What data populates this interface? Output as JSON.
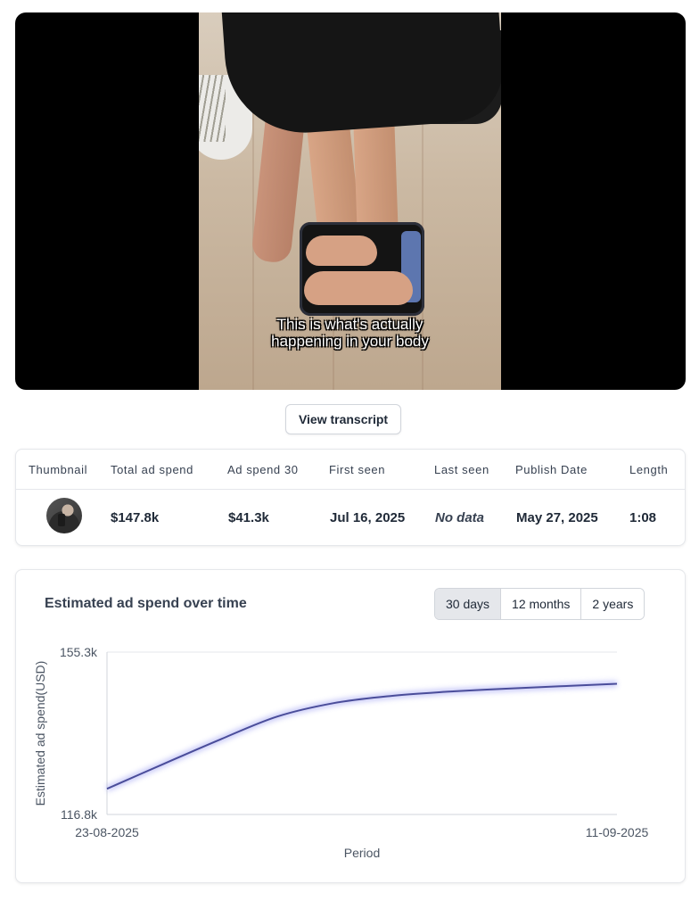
{
  "video": {
    "caption_line1": "This is what's actually",
    "caption_line2": "happening in your body"
  },
  "transcript_button": "View transcript",
  "ad_table": {
    "headers": [
      "Thumbnail",
      "Total ad spend",
      "Ad spend 30",
      "First seen",
      "Last seen",
      "Publish Date",
      "Length"
    ],
    "row": {
      "total_ad_spend": "$147.8k",
      "ad_spend_30": "$41.3k",
      "first_seen": "Jul 16, 2025",
      "last_seen": "No data",
      "publish_date": "May 27, 2025",
      "length": "1:08"
    }
  },
  "chart_panel": {
    "title": "Estimated ad spend over time",
    "ranges": [
      "30 days",
      "12 months",
      "2 years"
    ],
    "active_range": "30 days"
  },
  "chart_data": {
    "type": "line",
    "title": "Estimated ad spend over time",
    "xlabel": "Period",
    "ylabel": "Estimated ad spend(USD)",
    "x_tick_labels": [
      "23-08-2025",
      "11-09-2025"
    ],
    "y_tick_labels": [
      "155.3k",
      "116.8k"
    ],
    "ylim": [
      116.8,
      155.3
    ],
    "x": [
      "23-08-2025",
      "25-08-2025",
      "27-08-2025",
      "29-08-2025",
      "31-08-2025",
      "02-09-2025",
      "04-09-2025",
      "06-09-2025",
      "08-09-2025",
      "11-09-2025"
    ],
    "series": [
      {
        "values": [
          122.9,
          128.8,
          134.6,
          140.0,
          143.2,
          144.9,
          145.9,
          146.6,
          147.2,
          147.8
        ]
      }
    ],
    "line_color": "#4a4d9a",
    "grid": false
  }
}
